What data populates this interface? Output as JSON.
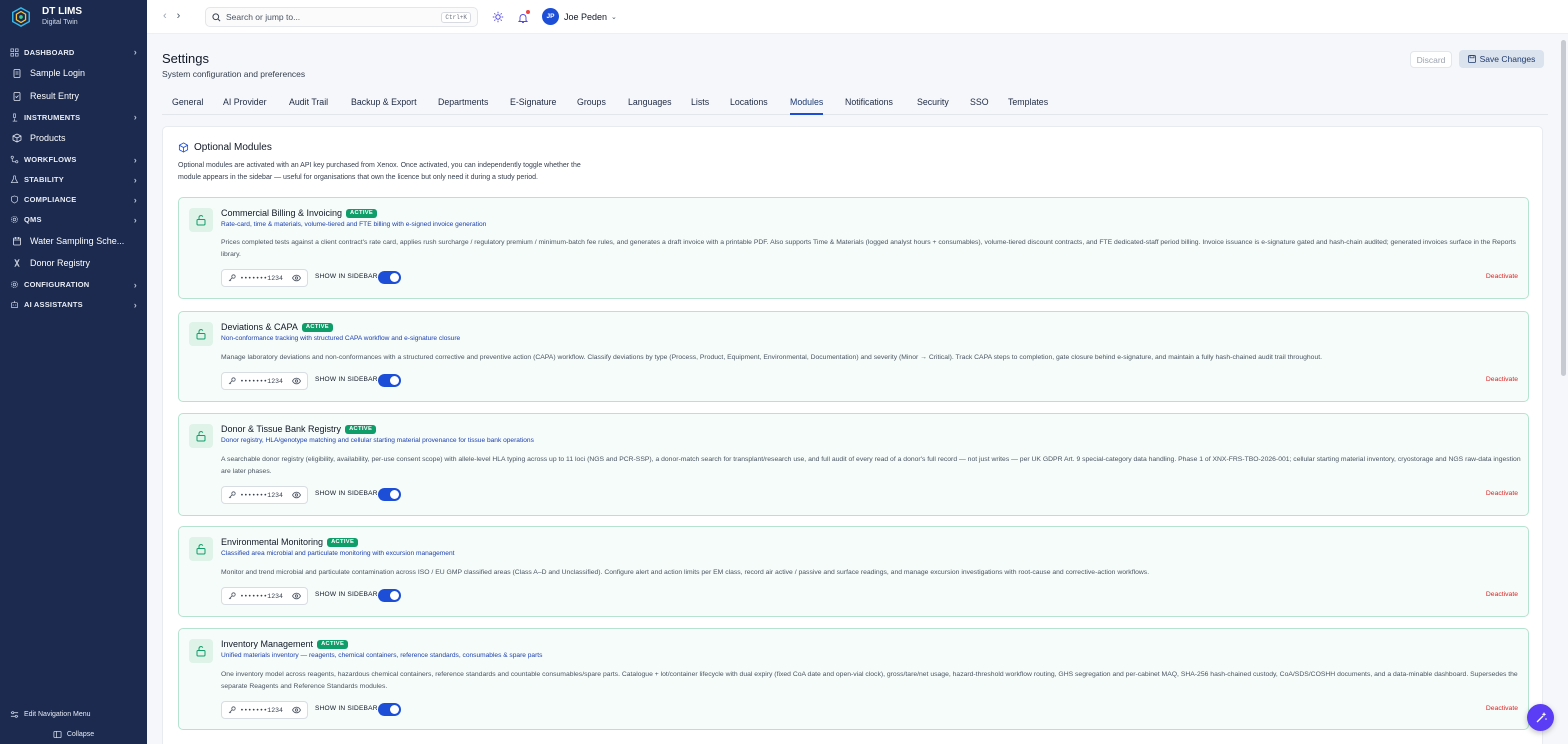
{
  "brand": {
    "name": "DT LIMS",
    "subtitle": "Digital Twin"
  },
  "sidebar": {
    "items": [
      {
        "type": "section",
        "label": "DASHBOARD",
        "icon": "grid-icon"
      },
      {
        "type": "link",
        "label": "Sample Login",
        "icon": "clipboard-icon"
      },
      {
        "type": "link",
        "label": "Result Entry",
        "icon": "clipboard-check-icon"
      },
      {
        "type": "section",
        "label": "INSTRUMENTS",
        "icon": "microscope-icon"
      },
      {
        "type": "link",
        "label": "Products",
        "icon": "box-icon"
      },
      {
        "type": "section",
        "label": "WORKFLOWS",
        "icon": "workflow-icon"
      },
      {
        "type": "section",
        "label": "STABILITY",
        "icon": "flask-icon"
      },
      {
        "type": "section",
        "label": "COMPLIANCE",
        "icon": "shield-icon"
      },
      {
        "type": "section",
        "label": "QMS",
        "icon": "gear-icon"
      },
      {
        "type": "link",
        "label": "Water Sampling Sche...",
        "icon": "calendar-icon"
      },
      {
        "type": "link",
        "label": "Donor Registry",
        "icon": "dna-icon"
      },
      {
        "type": "section",
        "label": "CONFIGURATION",
        "icon": "gear-icon"
      },
      {
        "type": "section",
        "label": "AI ASSISTANTS",
        "icon": "bot-icon"
      }
    ],
    "edit_label": "Edit Navigation Menu",
    "collapse_label": "Collapse"
  },
  "topbar": {
    "search_placeholder": "Search or jump to...",
    "search_shortcut": "Ctrl+K",
    "user_initials": "JP",
    "user_name": "Joe Peden"
  },
  "page": {
    "title": "Settings",
    "subtitle": "System configuration and preferences",
    "discard_label": "Discard",
    "save_label": "Save Changes"
  },
  "tabs": [
    {
      "label": "General"
    },
    {
      "label": "AI Provider"
    },
    {
      "label": "Audit Trail"
    },
    {
      "label": "Backup & Export"
    },
    {
      "label": "Departments"
    },
    {
      "label": "E-Signature"
    },
    {
      "label": "Groups"
    },
    {
      "label": "Languages"
    },
    {
      "label": "Lists"
    },
    {
      "label": "Locations"
    },
    {
      "label": "Modules",
      "active": true
    },
    {
      "label": "Notifications"
    },
    {
      "label": "Security"
    },
    {
      "label": "SSO"
    },
    {
      "label": "Templates"
    }
  ],
  "modules_panel": {
    "title": "Optional Modules",
    "description": "Optional modules are activated with an API key purchased from Xenox. Once activated, you can independently toggle whether the module appears in the sidebar — useful for organisations that own the licence but only need it during a study period."
  },
  "modules": [
    {
      "title": "Commercial Billing & Invoicing",
      "badge": "ACTIVE",
      "subtitle": "Rate-card, time & materials, volume-tiered and FTE billing with e-signed invoice generation",
      "description": "Prices completed tests against a client contract's rate card, applies rush surcharge / regulatory premium / minimum-batch fee rules, and generates a draft invoice with a printable PDF. Also supports Time & Materials (logged analyst hours + consumables), volume-tiered discount contracts, and FTE dedicated-staff period billing. Invoice issuance is e-signature gated and hash-chain audited; generated invoices surface in the Reports library.",
      "key": "•••••••1234",
      "show_label": "SHOW IN SIDEBAR",
      "show_in_sidebar": true,
      "deactivate_label": "Deactivate"
    },
    {
      "title": "Deviations & CAPA",
      "badge": "ACTIVE",
      "subtitle": "Non-conformance tracking with structured CAPA workflow and e-signature closure",
      "description": "Manage laboratory deviations and non-conformances with a structured corrective and preventive action (CAPA) workflow. Classify deviations by type (Process, Product, Equipment, Environmental, Documentation) and severity (Minor → Critical). Track CAPA steps to completion, gate closure behind e-signature, and maintain a fully hash-chained audit trail throughout.",
      "key": "•••••••1234",
      "show_label": "SHOW IN SIDEBAR",
      "show_in_sidebar": true,
      "deactivate_label": "Deactivate"
    },
    {
      "title": "Donor & Tissue Bank Registry",
      "badge": "ACTIVE",
      "subtitle": "Donor registry, HLA/genotype matching and cellular starting material provenance for tissue bank operations",
      "description": "A searchable donor registry (eligibility, availability, per-use consent scope) with allele-level HLA typing across up to 11 loci (NGS and PCR-SSP), a donor-match search for transplant/research use, and full audit of every read of a donor's full record — not just writes — per UK GDPR Art. 9 special-category data handling. Phase 1 of XNX-FRS-TBO-2026-001; cellular starting material inventory, cryostorage and NGS raw-data ingestion are later phases.",
      "key": "•••••••1234",
      "show_label": "SHOW IN SIDEBAR",
      "show_in_sidebar": true,
      "deactivate_label": "Deactivate"
    },
    {
      "title": "Environmental Monitoring",
      "badge": "ACTIVE",
      "subtitle": "Classified area microbial and particulate monitoring with excursion management",
      "description": "Monitor and trend microbial and particulate contamination across ISO / EU GMP classified areas (Class A–D and Unclassified). Configure alert and action limits per EM class, record air active / passive and surface readings, and manage excursion investigations with root-cause and corrective-action workflows.",
      "key": "•••••••1234",
      "show_label": "SHOW IN SIDEBAR",
      "show_in_sidebar": true,
      "deactivate_label": "Deactivate"
    },
    {
      "title": "Inventory Management",
      "badge": "ACTIVE",
      "subtitle": "Unified materials inventory — reagents, chemical containers, reference standards, consumables & spare parts",
      "description": "One inventory model across reagents, hazardous chemical containers, reference standards and countable consumables/spare parts. Catalogue + lot/container lifecycle with dual expiry (fixed CoA date and open-vial clock), gross/tare/net usage, hazard-threshold workflow routing, GHS segregation and per-cabinet MAQ, SHA-256 hash-chained custody, CoA/SDS/COSHH documents, and a data-minable dashboard. Supersedes the separate Reagents and Reference Standards modules.",
      "key": "•••••••1234",
      "show_label": "SHOW IN SIDEBAR",
      "show_in_sidebar": true,
      "deactivate_label": "Deactivate"
    }
  ],
  "colors": {
    "sidebar_bg": "#1b2a4e",
    "accent": "#1d4ed8",
    "active_badge": "#0f9d6a",
    "module_border": "#b6e3cf",
    "danger": "#dc2626"
  }
}
